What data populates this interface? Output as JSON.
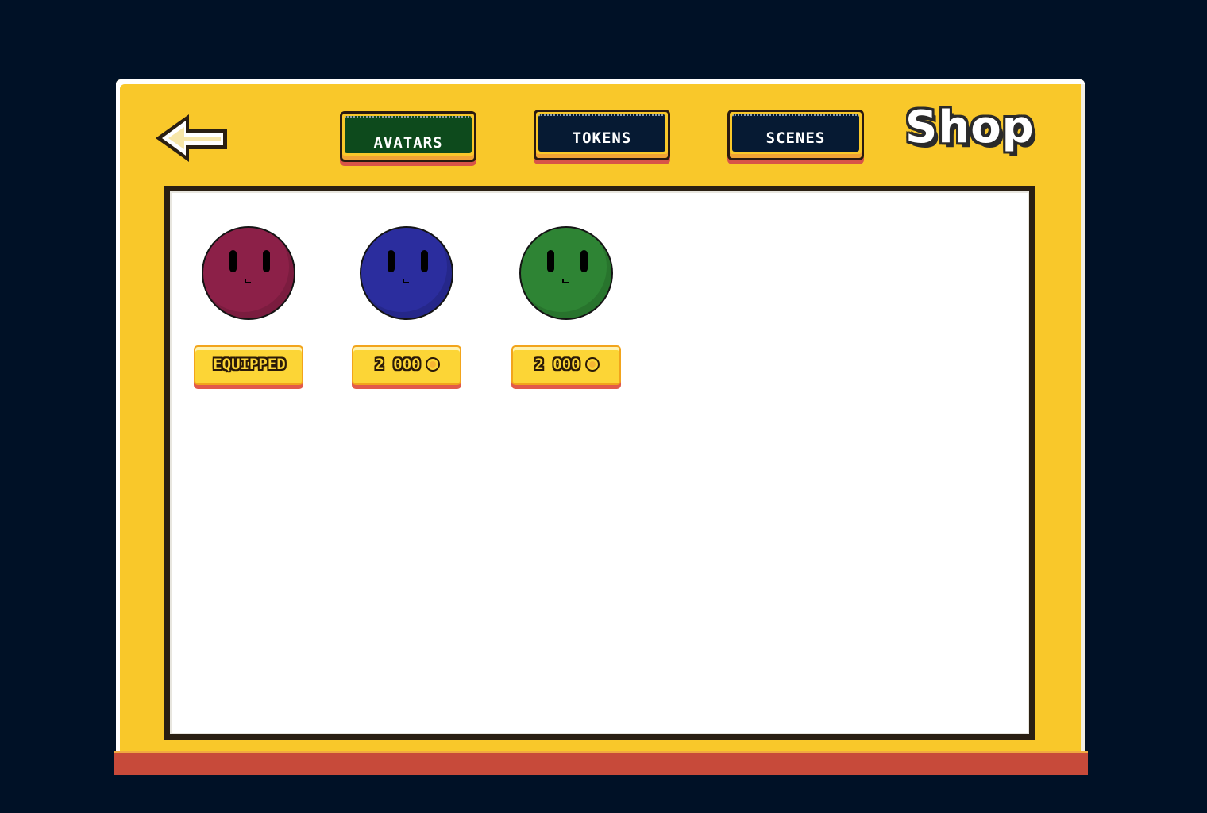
{
  "screen": {
    "title": "Shop",
    "background_color": "#001126"
  },
  "navigation": {
    "back_icon": "arrow-left-icon"
  },
  "tabs": [
    {
      "label": "AVATARS",
      "active": true,
      "color": "#0d4a1c"
    },
    {
      "label": "TOKENS",
      "active": false,
      "color": "#061a33"
    },
    {
      "label": "SCENES",
      "active": false,
      "color": "#061a33"
    }
  ],
  "items": [
    {
      "avatar_color": "#8c2048",
      "button_label": "EQUIPPED",
      "currency_icon": ""
    },
    {
      "avatar_color": "#2b2d9e",
      "button_label": "2 000",
      "currency_icon": "coin-icon"
    },
    {
      "avatar_color": "#2e8434",
      "button_label": "2 000",
      "currency_icon": "coin-icon"
    }
  ],
  "colors": {
    "panel": "#f9c82a",
    "panel_bottom": "#c74a3a",
    "price_button": "#fcd536"
  }
}
